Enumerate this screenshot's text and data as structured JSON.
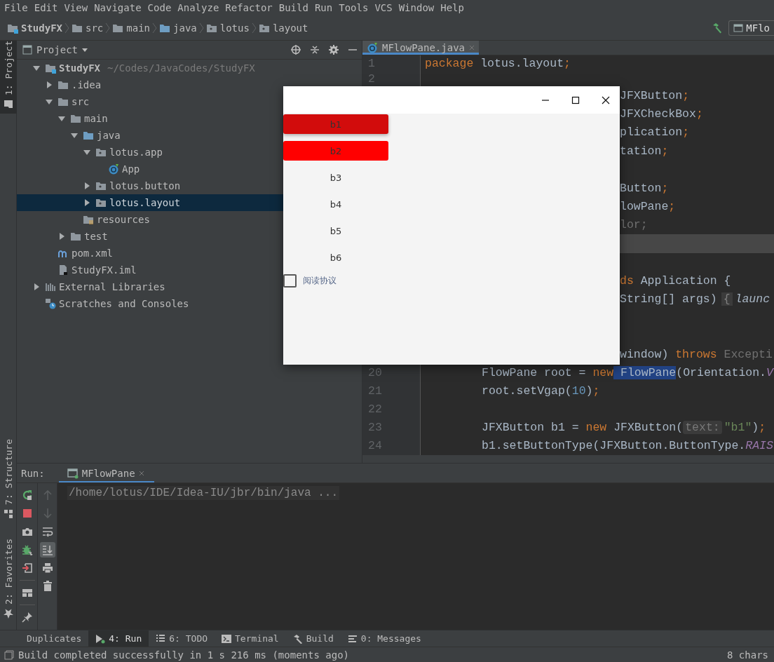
{
  "menu": [
    "File",
    "Edit",
    "View",
    "Navigate",
    "Code",
    "Analyze",
    "Refactor",
    "Build",
    "Run",
    "Tools",
    "VCS",
    "Window",
    "Help"
  ],
  "breadcrumbs": [
    {
      "label": "StudyFX",
      "kind": "module"
    },
    {
      "label": "src",
      "kind": "folder"
    },
    {
      "label": "main",
      "kind": "folder"
    },
    {
      "label": "java",
      "kind": "source"
    },
    {
      "label": "lotus",
      "kind": "package"
    },
    {
      "label": "layout",
      "kind": "package"
    }
  ],
  "run_config": "MFlo",
  "left_strip": {
    "top": [
      {
        "label": "1: Project",
        "kind": "project",
        "selected": true
      }
    ],
    "bottom": [
      {
        "label": "7: Structure",
        "kind": "structure",
        "selected": false
      },
      {
        "label": "2: Favorites",
        "kind": "favorites",
        "selected": false
      }
    ]
  },
  "project_panel": {
    "title": "Project",
    "tree": [
      {
        "label": "StudyFX",
        "kind": "module",
        "hint": "~/Codes/JavaCodes/StudyFX",
        "expanded": true,
        "selected": false,
        "children": [
          {
            "label": ".idea",
            "kind": "folder",
            "expanded": false,
            "selected": false
          },
          {
            "label": "src",
            "kind": "folder",
            "expanded": true,
            "selected": false,
            "children": [
              {
                "label": "main",
                "kind": "folder",
                "expanded": true,
                "selected": false,
                "children": [
                  {
                    "label": "java",
                    "kind": "source",
                    "expanded": true,
                    "selected": false,
                    "children": [
                      {
                        "label": "lotus.app",
                        "kind": "package",
                        "expanded": true,
                        "selected": false,
                        "children": [
                          {
                            "label": "App",
                            "kind": "class",
                            "selected": false
                          }
                        ]
                      },
                      {
                        "label": "lotus.button",
                        "kind": "package",
                        "expanded": false,
                        "selected": false
                      },
                      {
                        "label": "lotus.layout",
                        "kind": "package",
                        "expanded": false,
                        "selected": true
                      }
                    ]
                  },
                  {
                    "label": "resources",
                    "kind": "resources",
                    "selected": false
                  }
                ]
              },
              {
                "label": "test",
                "kind": "folder",
                "expanded": false,
                "selected": false
              }
            ]
          },
          {
            "label": "pom.xml",
            "kind": "maven",
            "selected": false
          },
          {
            "label": "StudyFX.iml",
            "kind": "iml",
            "selected": false
          }
        ]
      },
      {
        "label": "External Libraries",
        "kind": "libraries",
        "expanded": false,
        "selected": false
      },
      {
        "label": "Scratches and Consoles",
        "kind": "scratches",
        "selected": false
      }
    ]
  },
  "editor": {
    "tabs": [
      {
        "label": "MFlowPane.java",
        "selected": true
      }
    ],
    "lines": [
      {
        "number": "1",
        "kind": "top",
        "current": false,
        "tokens": [
          {
            "kind": "keyword",
            "text": "package"
          },
          {
            "kind": "plain",
            "text": " lotus.layout"
          },
          {
            "kind": "keyword",
            "text": ";"
          }
        ]
      },
      {
        "number": "2",
        "kind": "top",
        "current": false
      },
      {
        "kind": "partial",
        "current": false,
        "tokens": [
          {
            "kind": "plain",
            "text": "JFXButton"
          },
          {
            "kind": "keyword",
            "text": ";"
          }
        ]
      },
      {
        "kind": "partial",
        "current": false,
        "tokens": [
          {
            "kind": "plain",
            "text": "JFXCheckBox"
          },
          {
            "kind": "keyword",
            "text": ";"
          }
        ]
      },
      {
        "kind": "partial",
        "current": false,
        "tokens": [
          {
            "kind": "plain",
            "text": "plication"
          },
          {
            "kind": "keyword",
            "text": ";"
          }
        ]
      },
      {
        "kind": "partial",
        "current": false,
        "tokens": [
          {
            "kind": "plain",
            "text": "tation"
          },
          {
            "kind": "keyword",
            "text": ";"
          }
        ]
      },
      {
        "kind": "partial",
        "current": false
      },
      {
        "kind": "partial",
        "current": false,
        "tokens": [
          {
            "kind": "plain",
            "text": "Button"
          },
          {
            "kind": "keyword",
            "text": ";"
          }
        ]
      },
      {
        "kind": "partial",
        "current": false,
        "tokens": [
          {
            "kind": "plain",
            "text": "lowPane"
          },
          {
            "kind": "keyword",
            "text": ";"
          }
        ]
      },
      {
        "kind": "partial",
        "current": false,
        "tokens": [
          {
            "kind": "dim",
            "text": "lor;"
          }
        ]
      },
      {
        "kind": "partial",
        "current": true
      },
      {
        "kind": "partial",
        "current": false
      },
      {
        "kind": "partial",
        "current": false,
        "tokens": [
          {
            "kind": "keyword",
            "text": "ds"
          },
          {
            "kind": "plain",
            "text": " Application {"
          }
        ]
      },
      {
        "kind": "partial",
        "current": false,
        "tokens": [
          {
            "kind": "plain",
            "text": "String[] args)"
          },
          {
            "kind": "fold",
            "text": "{"
          },
          {
            "kind": "italic",
            "text": "launc"
          }
        ]
      },
      {
        "kind": "partial",
        "current": false
      },
      {
        "kind": "partial",
        "current": false
      },
      {
        "kind": "partial",
        "current": false,
        "tokens": [
          {
            "kind": "plain",
            "text": "window) "
          },
          {
            "kind": "keyword",
            "text": "throws"
          },
          {
            "kind": "dim",
            "text": " Excepti"
          }
        ]
      },
      {
        "number": "20",
        "kind": "body",
        "current": false,
        "tokens": [
          {
            "kind": "plain",
            "text": "FlowPane root = "
          },
          {
            "kind": "keyword",
            "text": "new"
          },
          {
            "kind": "match",
            "text": " FlowPane"
          },
          {
            "kind": "plain",
            "text": "(Orientation."
          },
          {
            "kind": "constant",
            "text": "V"
          }
        ]
      },
      {
        "number": "21",
        "kind": "body",
        "current": false,
        "tokens": [
          {
            "kind": "plain",
            "text": "root.setVgap("
          },
          {
            "kind": "number",
            "text": "10"
          },
          {
            "kind": "plain",
            "text": ")"
          },
          {
            "kind": "keyword",
            "text": ";"
          }
        ]
      },
      {
        "number": "22",
        "kind": "body",
        "current": false
      },
      {
        "number": "23",
        "kind": "body",
        "current": false,
        "tokens": [
          {
            "kind": "plain",
            "text": "JFXButton b1 = "
          },
          {
            "kind": "keyword",
            "text": "new"
          },
          {
            "kind": "plain",
            "text": " JFXButton("
          },
          {
            "kind": "hint",
            "text": "text:"
          },
          {
            "kind": "string",
            "text": "\"b1\""
          },
          {
            "kind": "plain",
            "text": ")"
          },
          {
            "kind": "keyword",
            "text": ";"
          }
        ]
      },
      {
        "number": "24",
        "kind": "body",
        "current": false,
        "tokens": [
          {
            "kind": "plain",
            "text": "b1.setButtonType(JFXButton.ButtonType."
          },
          {
            "kind": "constant",
            "text": "RAIS"
          }
        ]
      }
    ]
  },
  "run_panel": {
    "label": "Run:",
    "tabs": [
      {
        "label": "MFlowPane",
        "selected": true
      }
    ],
    "console": [
      "/home/lotus/IDE/Idea-IU/jbr/bin/java ..."
    ]
  },
  "bottom_tabs": [
    {
      "label": "Duplicates",
      "kind": "plain",
      "selected": false
    },
    {
      "label": "4: Run",
      "kind": "run",
      "selected": true
    },
    {
      "label": "6: TODO",
      "kind": "todo",
      "selected": false
    },
    {
      "label": "Terminal",
      "kind": "terminal",
      "selected": false
    },
    {
      "label": "Build",
      "kind": "build",
      "selected": false
    },
    {
      "label": "0: Messages",
      "kind": "messages",
      "selected": false
    }
  ],
  "status_bar": {
    "message": "Build completed successfully in 1 s 216 ms (moments ago)",
    "right": "8 chars"
  },
  "app_window": {
    "buttons": [
      {
        "label": "b1",
        "kind": "raised",
        "color": "#d20c0c"
      },
      {
        "label": "b2",
        "kind": "filled",
        "color": "#ff0000"
      },
      {
        "label": "b3",
        "kind": "flat"
      },
      {
        "label": "b4",
        "kind": "flat"
      },
      {
        "label": "b5",
        "kind": "flat"
      },
      {
        "label": "b6",
        "kind": "flat"
      }
    ],
    "checkbox": {
      "label": "阅读协议",
      "checked": false
    }
  }
}
